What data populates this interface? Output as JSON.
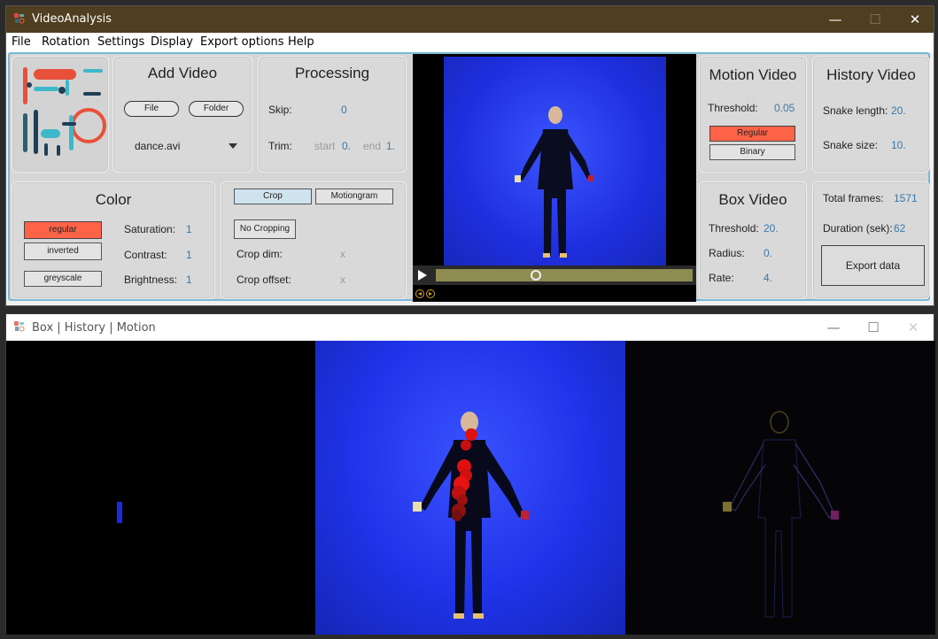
{
  "main_window": {
    "title": "VideoAnalysis",
    "controls": {
      "minimize": "—",
      "maximize": "☐",
      "close": "✕"
    }
  },
  "menu": [
    "File",
    "Rotation",
    "Settings",
    "Display",
    "Export options",
    "Help"
  ],
  "add_video": {
    "title": "Add Video",
    "file_button": "File",
    "folder_button": "Folder",
    "selected_file": "dance.avi"
  },
  "processing": {
    "title": "Processing",
    "skip_label": "Skip:",
    "skip_value": "0",
    "trim_label": "Trim:",
    "trim_start_label": "start",
    "trim_start_value": "0.",
    "trim_end_label": "end",
    "trim_end_value": "1."
  },
  "color": {
    "title": "Color",
    "regular_button": "regular",
    "inverted_button": "inverted",
    "greyscale_button": "greyscale",
    "saturation_label": "Saturation:",
    "saturation_value": "1",
    "contrast_label": "Contrast:",
    "contrast_value": "1",
    "brightness_label": "Brightness:",
    "brightness_value": "1"
  },
  "crop": {
    "crop_tab": "Crop",
    "motiongram_tab": "Motiongram",
    "no_cropping_button": "No Cropping",
    "crop_dim_label": "Crop dim:",
    "crop_dim_value": "x",
    "crop_offset_label": "Crop offset:",
    "crop_offset_value": "x"
  },
  "motion_video": {
    "title": "Motion Video",
    "threshold_label": "Threshold:",
    "threshold_value": "0.05",
    "regular_button": "Regular",
    "binary_button": "Binary"
  },
  "history_video": {
    "title": "History Video",
    "snake_length_label": "Snake length:",
    "snake_length_value": "20.",
    "snake_size_label": "Snake size:",
    "snake_size_value": "10."
  },
  "box_video": {
    "title": "Box Video",
    "threshold_label": "Threshold:",
    "threshold_value": "20.",
    "radius_label": "Radius:",
    "radius_value": "0.",
    "rate_label": "Rate:",
    "rate_value": "4."
  },
  "stats": {
    "total_frames_label": "Total frames:",
    "total_frames_value": "1571",
    "duration_label": "Duration (sek):",
    "duration_value": "62",
    "export_button": "Export data"
  },
  "player": {
    "play_icon": "play-icon",
    "progress": 0.39
  },
  "second_window": {
    "title": "Box | History | Motion",
    "controls": {
      "minimize": "—",
      "maximize": "☐",
      "close": "✕"
    }
  },
  "colors": {
    "titlebar": "#4f3e1f",
    "accent_red": "#ff6347",
    "value_blue": "#3a78a8",
    "video_blue": "#2336e6"
  }
}
